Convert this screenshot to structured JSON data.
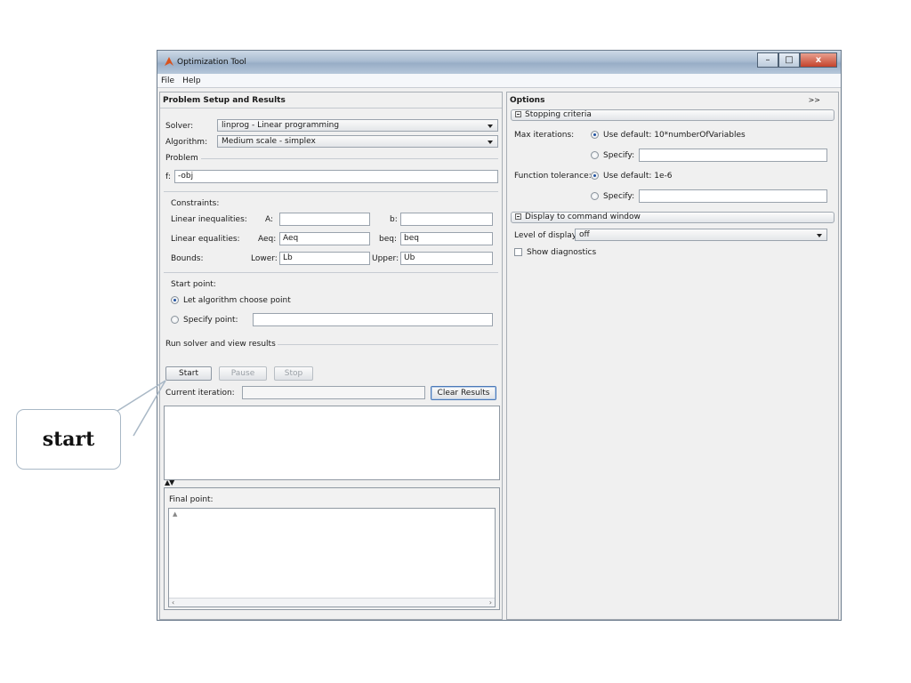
{
  "window": {
    "title": "Optimization Tool",
    "minimize": "–",
    "maximize": "□",
    "close": "x"
  },
  "menu": {
    "items": [
      "File",
      "Help"
    ]
  },
  "left_panel": {
    "title": "Problem Setup and Results",
    "solver": {
      "label": "Solver:",
      "value": "linprog - Linear programming"
    },
    "algorithm": {
      "label": "Algorithm:",
      "value": "Medium scale - simplex"
    },
    "problem": {
      "label": "Problem",
      "f_label": "f:",
      "f_value": "-obj"
    },
    "constraints": {
      "label": "Constraints:",
      "lin_ineq": {
        "label": "Linear inequalities:",
        "a_label": "A:",
        "a_value": "",
        "b_label": "b:",
        "b_value": ""
      },
      "lin_eq": {
        "label": "Linear equalities:",
        "aeq_label": "Aeq:",
        "aeq_value": "Aeq",
        "beq_label": "beq:",
        "beq_value": "beq"
      },
      "bounds": {
        "label": "Bounds:",
        "lower_label": "Lower:",
        "lower_value": "Lb",
        "upper_label": "Upper:",
        "upper_value": "Ub"
      }
    },
    "start_point": {
      "label": "Start point:",
      "option_auto": "Let algorithm choose point",
      "option_specify": "Specify point:",
      "specify_value": "",
      "selected": "auto"
    },
    "run": {
      "label": "Run solver and view results",
      "start": "Start",
      "pause": "Pause",
      "stop": "Stop",
      "current_iteration_label": "Current iteration:",
      "current_iteration_value": "",
      "clear_results": "Clear Results",
      "divider_arrows": "▲▼",
      "final_point_label": "Final point:"
    }
  },
  "right_panel": {
    "title": "Options",
    "expand": ">>",
    "stopping": {
      "header": "Stopping criteria",
      "max_iter_label": "Max iterations:",
      "max_iter_default": "Use default: 10*numberOfVariables",
      "max_iter_specify": "Specify:",
      "max_iter_value": "",
      "fun_tol_label": "Function tolerance:",
      "fun_tol_default": "Use default: 1e-6",
      "fun_tol_specify": "Specify:",
      "fun_tol_value": ""
    },
    "display": {
      "header": "Display to command window",
      "level_label": "Level of display:",
      "level_value": "off",
      "diagnostics": "Show diagnostics"
    }
  },
  "annotation": {
    "text": "start"
  },
  "colors": {
    "accent": "#1e50a0",
    "titlebar": "#a9bcd1",
    "close": "#c4432c"
  }
}
